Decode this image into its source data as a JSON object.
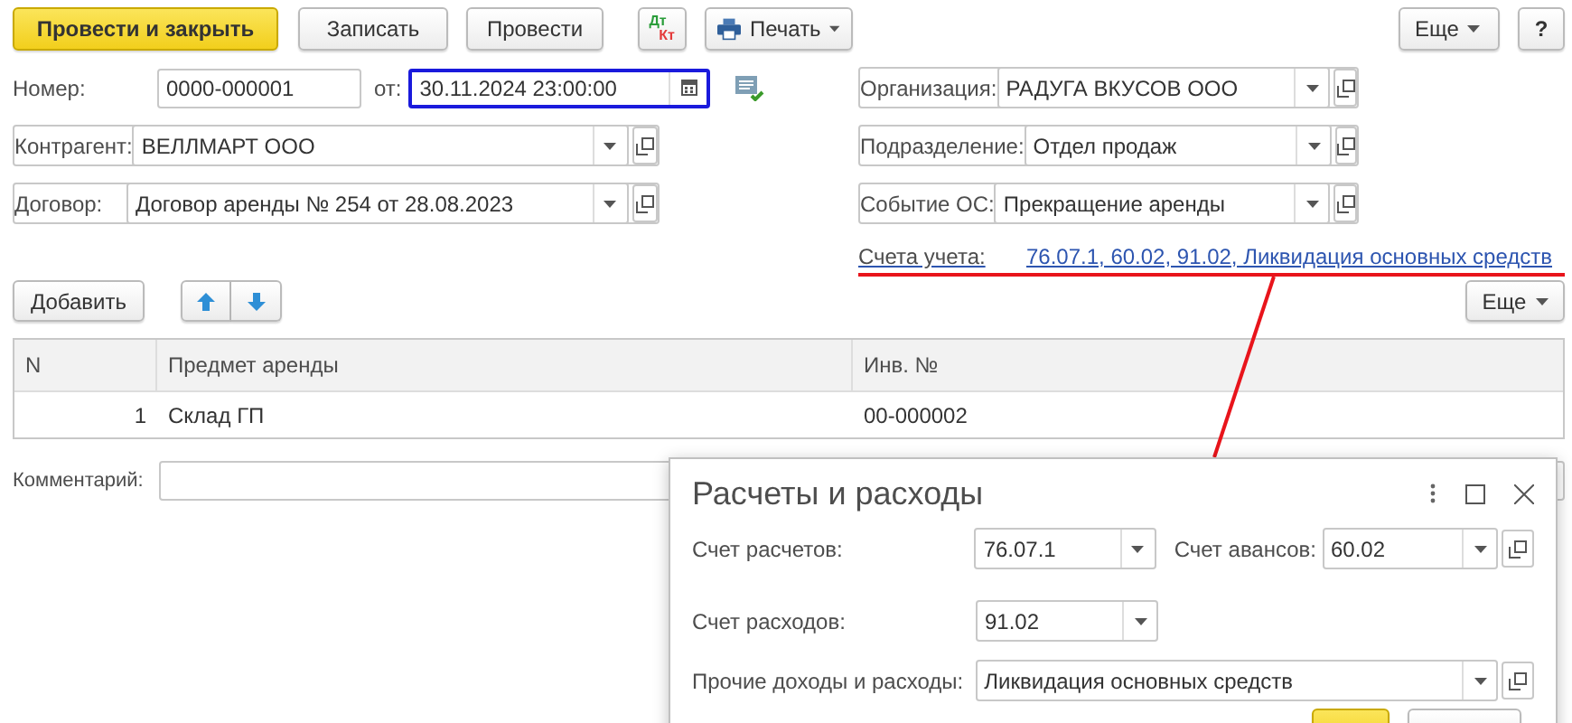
{
  "toolbar": {
    "buttons": [
      {
        "kind": "primary",
        "label": "Провести и закрыть"
      },
      {
        "kind": "normal",
        "label": "Записать"
      },
      {
        "kind": "normal",
        "label": "Провести"
      },
      {
        "kind": "dtkt",
        "label": "Дт",
        "label2": "Кт"
      },
      {
        "kind": "print",
        "label": "Печать"
      }
    ],
    "right": [
      {
        "kind": "menu",
        "label": "Еще"
      },
      {
        "kind": "normal",
        "label": "?"
      }
    ]
  },
  "header": {
    "left": [
      {
        "kind": "number",
        "label": "Номер:",
        "value": "0000-000001",
        "date_label": "от:",
        "date": "30.11.2024 23:00:00",
        "date_focused": true
      },
      {
        "kind": "select",
        "label": "Контрагент:",
        "value": "ВЕЛЛМАРТ ООО"
      },
      {
        "kind": "select",
        "label": "Договор:",
        "value": "Договор аренды № 254 от 28.08.2023"
      }
    ],
    "right": [
      {
        "kind": "select",
        "label": "Организация:",
        "value": "РАДУГА ВКУСОВ ООО"
      },
      {
        "kind": "select",
        "label": "Подразделение:",
        "value": "Отдел продаж"
      },
      {
        "kind": "select",
        "label": "Событие ОС:",
        "value": "Прекращение аренды"
      },
      {
        "kind": "link",
        "label": "Счета учета:",
        "value": "76.07.1, 60.02, 91.02, Ликвидация основных средств"
      }
    ]
  },
  "table_toolbar": {
    "add": "Добавить",
    "more": "Еще"
  },
  "table": {
    "columns": [
      "N",
      "Предмет аренды",
      "Инв. №"
    ],
    "rows": [
      [
        "1",
        "Склад ГП",
        "00-000002"
      ]
    ]
  },
  "comment": {
    "label": "Комментарий:"
  },
  "dialog": {
    "title": "Расчеты и расходы",
    "rows": [
      {
        "fields": [
          {
            "label": "Счет расчетов:",
            "value": "76.07.1",
            "copy": false
          },
          {
            "label": "Счет авансов:",
            "value": "60.02",
            "copy": true
          }
        ]
      },
      {
        "fields": [
          {
            "label": "Счет расходов:",
            "value": "91.02",
            "copy": false
          }
        ]
      },
      {
        "fields": [
          {
            "label": "Прочие доходы и расходы:",
            "value": "Ликвидация основных средств",
            "copy": true
          }
        ]
      }
    ],
    "buttons": [
      {
        "kind": "primary"
      },
      {
        "kind": "normal"
      }
    ]
  }
}
